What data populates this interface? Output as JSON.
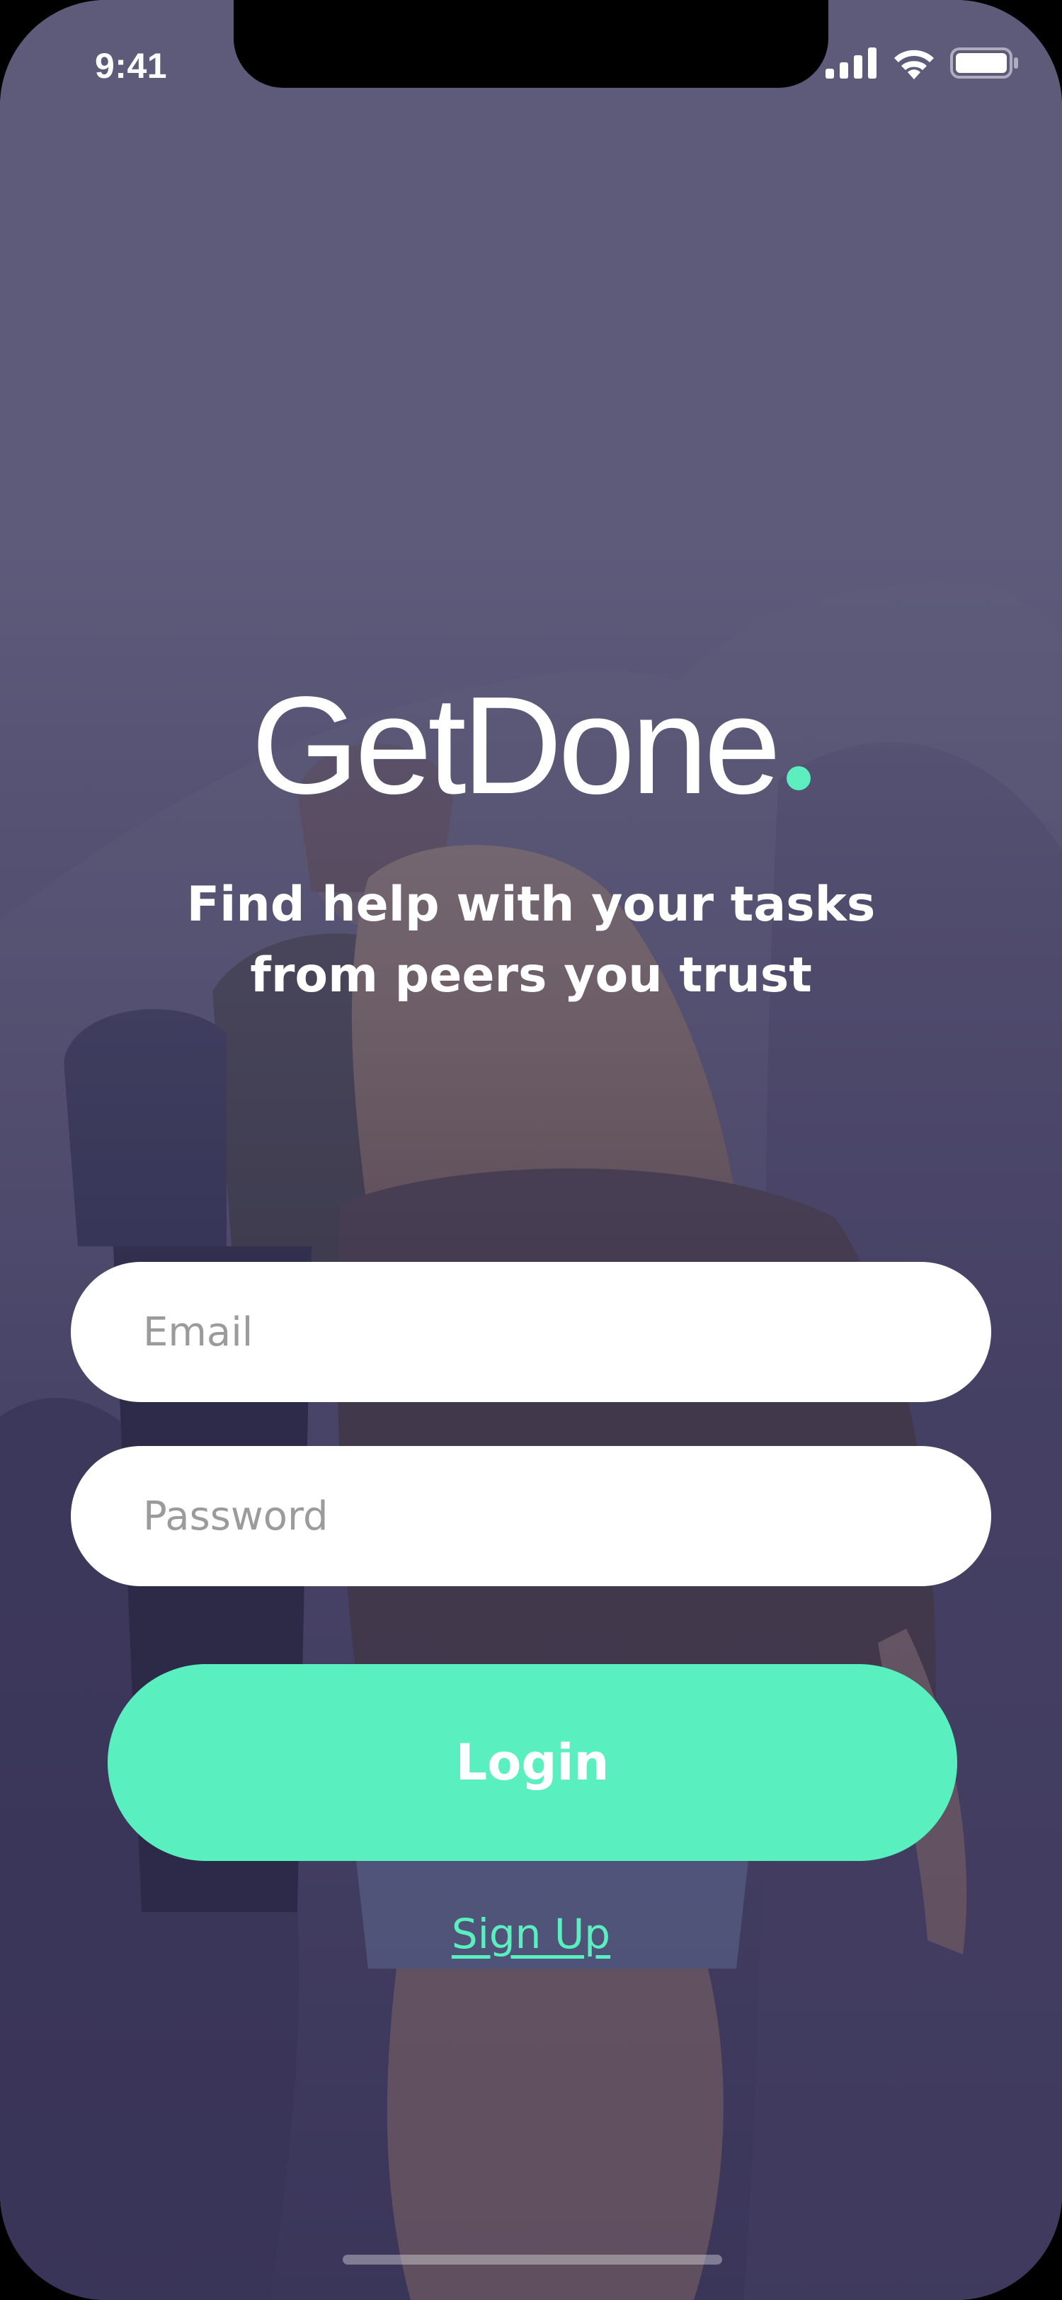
{
  "status_bar": {
    "time": "9:41",
    "icons": [
      "signal-icon",
      "wifi-icon",
      "battery-icon"
    ]
  },
  "brand": {
    "name": "GetDone",
    "accent_color": "#5aefbf",
    "overlay_color": "#5d5a7a"
  },
  "tagline": {
    "line1": "Find help with your tasks",
    "line2": "from peers you trust"
  },
  "form": {
    "email_placeholder": "Email",
    "email_value": "",
    "password_placeholder": "Password",
    "password_value": ""
  },
  "actions": {
    "login_label": "Login",
    "signup_label": "Sign Up"
  }
}
